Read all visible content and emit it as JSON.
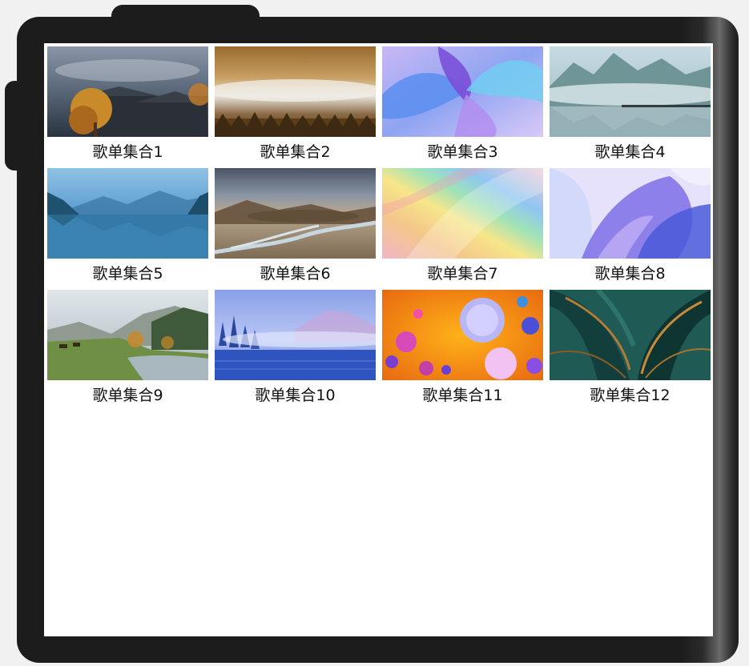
{
  "playlists": [
    {
      "title": "歌单集合1",
      "image": "autumn-village-image"
    },
    {
      "title": "歌单集合2",
      "image": "misty-valley-village-image"
    },
    {
      "title": "歌单集合3",
      "image": "purple-abstract-flower-image"
    },
    {
      "title": "歌单集合4",
      "image": "misty-mountain-lake-image"
    },
    {
      "title": "歌单集合5",
      "image": "blue-lake-reflection-image"
    },
    {
      "title": "歌单集合6",
      "image": "desert-river-landscape-image"
    },
    {
      "title": "歌单集合7",
      "image": "rainbow-gradient-abstract-image"
    },
    {
      "title": "歌单集合8",
      "image": "violet-petal-abstract-image"
    },
    {
      "title": "歌单集合9",
      "image": "meadow-river-horses-image"
    },
    {
      "title": "歌单集合10",
      "image": "blue-misty-lake-image"
    },
    {
      "title": "歌单集合11",
      "image": "colorful-bubbles-image"
    },
    {
      "title": "歌单集合12",
      "image": "teal-leaves-abstract-image"
    }
  ],
  "colors": {
    "frame": "#1c1c1c",
    "screen": "#ffffff",
    "page_background": "#f1f1f1",
    "title_text": "#111111"
  }
}
